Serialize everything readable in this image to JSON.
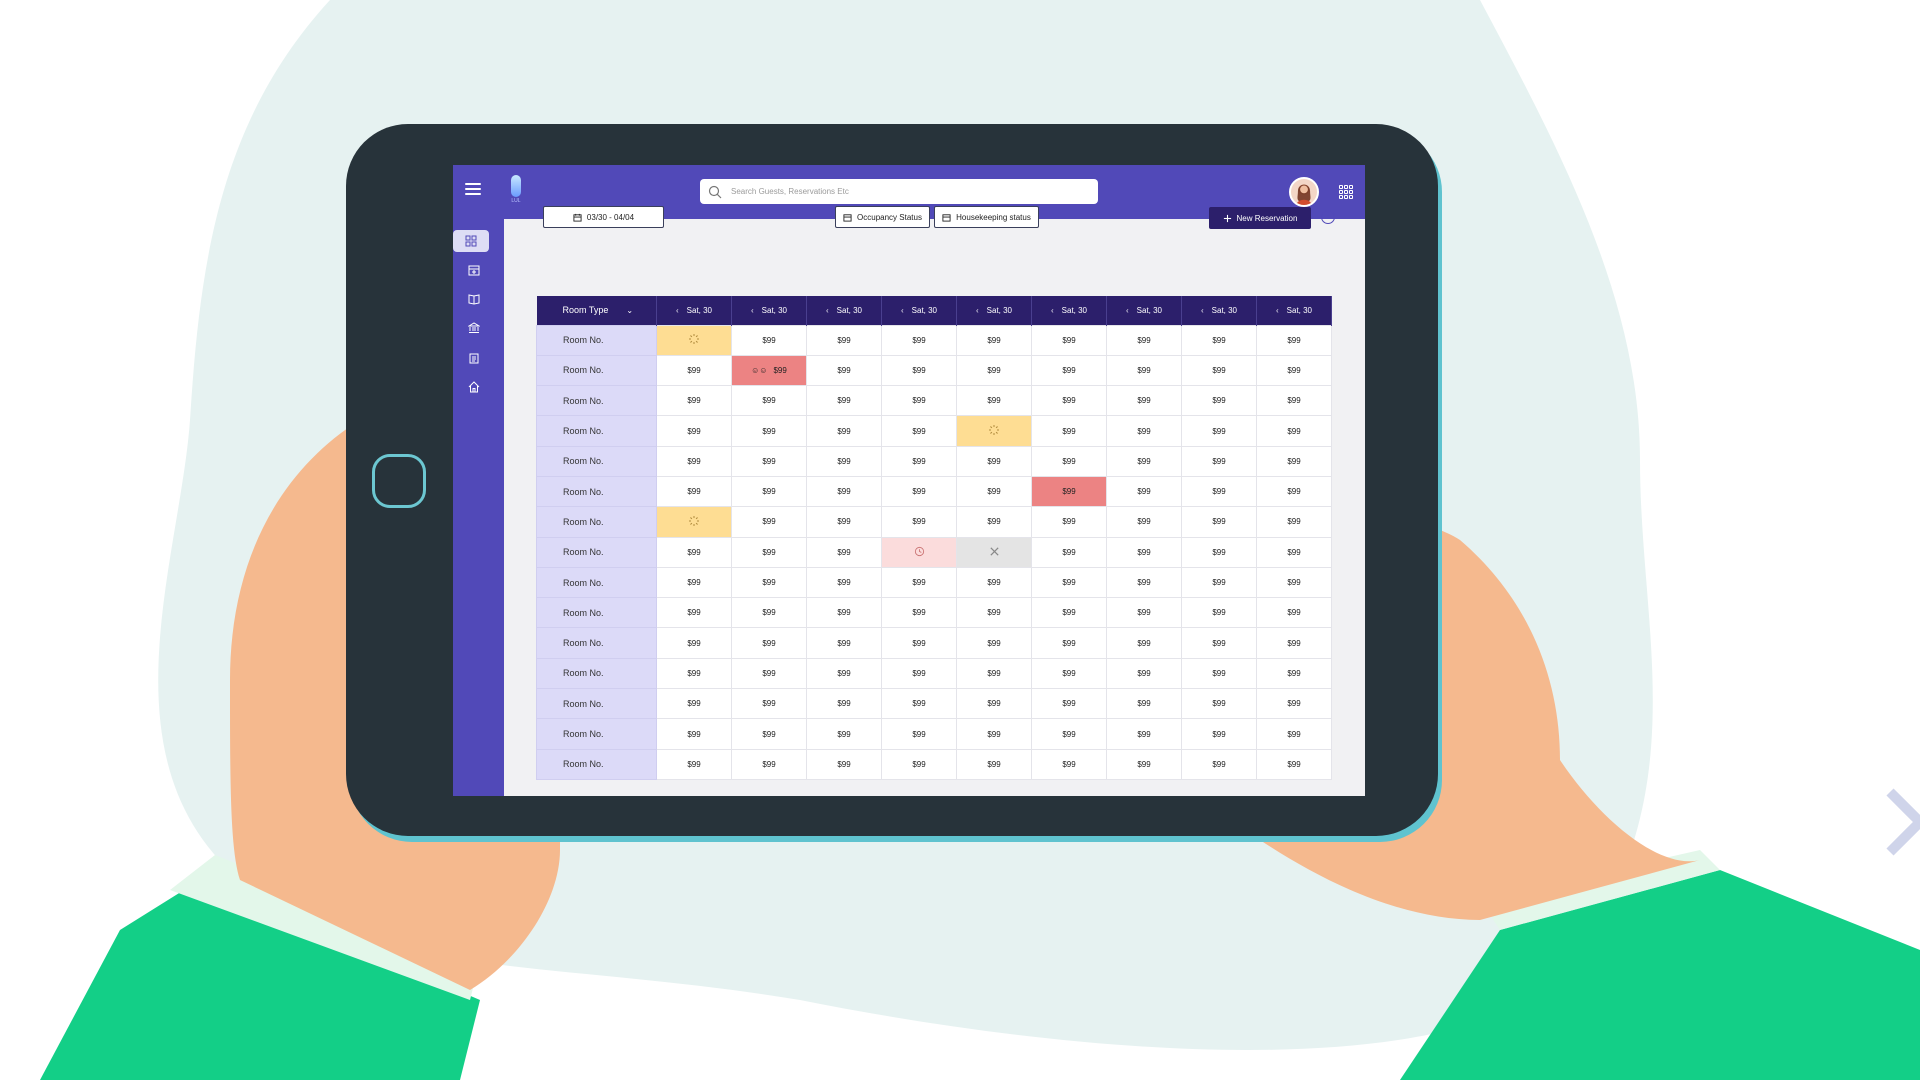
{
  "app": {
    "logo_text": "LUL",
    "search_placeholder": "Search Guests, Reservations Etc",
    "sidebar_items": [
      "dashboard-icon",
      "calendar-icon",
      "book-icon",
      "bank-icon",
      "clipboard-icon",
      "home-icon"
    ]
  },
  "toolbar": {
    "date_range": "03/30 - 04/04",
    "occupancy_label": "Occupancy Status",
    "housekeeping_label": "Housekeeping status",
    "new_reservation_label": "New Reservation",
    "info_glyph": "i"
  },
  "grid": {
    "header_label": "Room Type",
    "columns": [
      "Sat, 30",
      "Sat, 30",
      "Sat, 30",
      "Sat, 30",
      "Sat, 30",
      "Sat, 30",
      "Sat, 30",
      "Sat, 30",
      "Sat, 30"
    ],
    "rows": [
      {
        "label": "Room No.",
        "cells": [
          {
            "t": "",
            "s": "yellow",
            "i": "loading"
          },
          {
            "t": "$99"
          },
          {
            "t": "$99"
          },
          {
            "t": "$99"
          },
          {
            "t": "$99"
          },
          {
            "t": "$99"
          },
          {
            "t": "$99"
          },
          {
            "t": "$99"
          },
          {
            "t": "$99"
          }
        ]
      },
      {
        "label": "Room No.",
        "cells": [
          {
            "t": "$99"
          },
          {
            "t": "$99",
            "s": "red",
            "i": "people"
          },
          {
            "t": "$99"
          },
          {
            "t": "$99"
          },
          {
            "t": "$99"
          },
          {
            "t": "$99"
          },
          {
            "t": "$99"
          },
          {
            "t": "$99"
          },
          {
            "t": "$99"
          }
        ]
      },
      {
        "label": "Room No.",
        "cells": [
          {
            "t": "$99"
          },
          {
            "t": "$99"
          },
          {
            "t": "$99"
          },
          {
            "t": "$99"
          },
          {
            "t": "$99"
          },
          {
            "t": "$99"
          },
          {
            "t": "$99"
          },
          {
            "t": "$99"
          },
          {
            "t": "$99"
          }
        ]
      },
      {
        "label": "Room No.",
        "cells": [
          {
            "t": "$99"
          },
          {
            "t": "$99"
          },
          {
            "t": "$99"
          },
          {
            "t": "$99"
          },
          {
            "t": "",
            "s": "yellow",
            "i": "loading"
          },
          {
            "t": "$99"
          },
          {
            "t": "$99"
          },
          {
            "t": "$99"
          },
          {
            "t": "$99"
          }
        ]
      },
      {
        "label": "Room No.",
        "cells": [
          {
            "t": "$99"
          },
          {
            "t": "$99"
          },
          {
            "t": "$99"
          },
          {
            "t": "$99"
          },
          {
            "t": "$99"
          },
          {
            "t": "$99"
          },
          {
            "t": "$99"
          },
          {
            "t": "$99"
          },
          {
            "t": "$99"
          }
        ]
      },
      {
        "label": "Room No.",
        "cells": [
          {
            "t": "$99"
          },
          {
            "t": "$99"
          },
          {
            "t": "$99"
          },
          {
            "t": "$99"
          },
          {
            "t": "$99"
          },
          {
            "t": "$99",
            "s": "red"
          },
          {
            "t": "$99"
          },
          {
            "t": "$99"
          },
          {
            "t": "$99"
          }
        ]
      },
      {
        "label": "Room No.",
        "cells": [
          {
            "t": "",
            "s": "yellow",
            "i": "loading"
          },
          {
            "t": "$99"
          },
          {
            "t": "$99"
          },
          {
            "t": "$99"
          },
          {
            "t": "$99"
          },
          {
            "t": "$99"
          },
          {
            "t": "$99"
          },
          {
            "t": "$99"
          },
          {
            "t": "$99"
          }
        ]
      },
      {
        "label": "Room No.",
        "cells": [
          {
            "t": "$99"
          },
          {
            "t": "$99"
          },
          {
            "t": "$99"
          },
          {
            "t": "",
            "s": "pink",
            "i": "clock"
          },
          {
            "t": "",
            "s": "grey",
            "i": "tools"
          },
          {
            "t": "$99"
          },
          {
            "t": "$99"
          },
          {
            "t": "$99"
          },
          {
            "t": "$99"
          }
        ]
      },
      {
        "label": "Room No.",
        "cells": [
          {
            "t": "$99"
          },
          {
            "t": "$99"
          },
          {
            "t": "$99"
          },
          {
            "t": "$99"
          },
          {
            "t": "$99"
          },
          {
            "t": "$99"
          },
          {
            "t": "$99"
          },
          {
            "t": "$99"
          },
          {
            "t": "$99"
          }
        ]
      },
      {
        "label": "Room No.",
        "cells": [
          {
            "t": "$99"
          },
          {
            "t": "$99"
          },
          {
            "t": "$99"
          },
          {
            "t": "$99"
          },
          {
            "t": "$99"
          },
          {
            "t": "$99"
          },
          {
            "t": "$99"
          },
          {
            "t": "$99"
          },
          {
            "t": "$99"
          }
        ]
      },
      {
        "label": "Room No.",
        "cells": [
          {
            "t": "$99"
          },
          {
            "t": "$99"
          },
          {
            "t": "$99"
          },
          {
            "t": "$99"
          },
          {
            "t": "$99"
          },
          {
            "t": "$99"
          },
          {
            "t": "$99"
          },
          {
            "t": "$99"
          },
          {
            "t": "$99"
          }
        ]
      },
      {
        "label": "Room No.",
        "cells": [
          {
            "t": "$99"
          },
          {
            "t": "$99"
          },
          {
            "t": "$99"
          },
          {
            "t": "$99"
          },
          {
            "t": "$99"
          },
          {
            "t": "$99"
          },
          {
            "t": "$99"
          },
          {
            "t": "$99"
          },
          {
            "t": "$99"
          }
        ]
      },
      {
        "label": "Room No.",
        "cells": [
          {
            "t": "$99"
          },
          {
            "t": "$99"
          },
          {
            "t": "$99"
          },
          {
            "t": "$99"
          },
          {
            "t": "$99"
          },
          {
            "t": "$99"
          },
          {
            "t": "$99"
          },
          {
            "t": "$99"
          },
          {
            "t": "$99"
          }
        ]
      },
      {
        "label": "Room No.",
        "cells": [
          {
            "t": "$99"
          },
          {
            "t": "$99"
          },
          {
            "t": "$99"
          },
          {
            "t": "$99"
          },
          {
            "t": "$99"
          },
          {
            "t": "$99"
          },
          {
            "t": "$99"
          },
          {
            "t": "$99"
          },
          {
            "t": "$99"
          }
        ]
      },
      {
        "label": "Room No.",
        "cells": [
          {
            "t": "$99"
          },
          {
            "t": "$99"
          },
          {
            "t": "$99"
          },
          {
            "t": "$99"
          },
          {
            "t": "$99"
          },
          {
            "t": "$99"
          },
          {
            "t": "$99"
          },
          {
            "t": "$99"
          },
          {
            "t": "$99"
          }
        ]
      }
    ]
  },
  "colors": {
    "brand": "#5149b8",
    "header": "#2c1f6b",
    "room_cell": "#dcdaf8",
    "pending": "#fedd93",
    "occupied": "#ec8383",
    "scheduled": "#fbdcdc",
    "maintenance": "#e4e4e4"
  }
}
